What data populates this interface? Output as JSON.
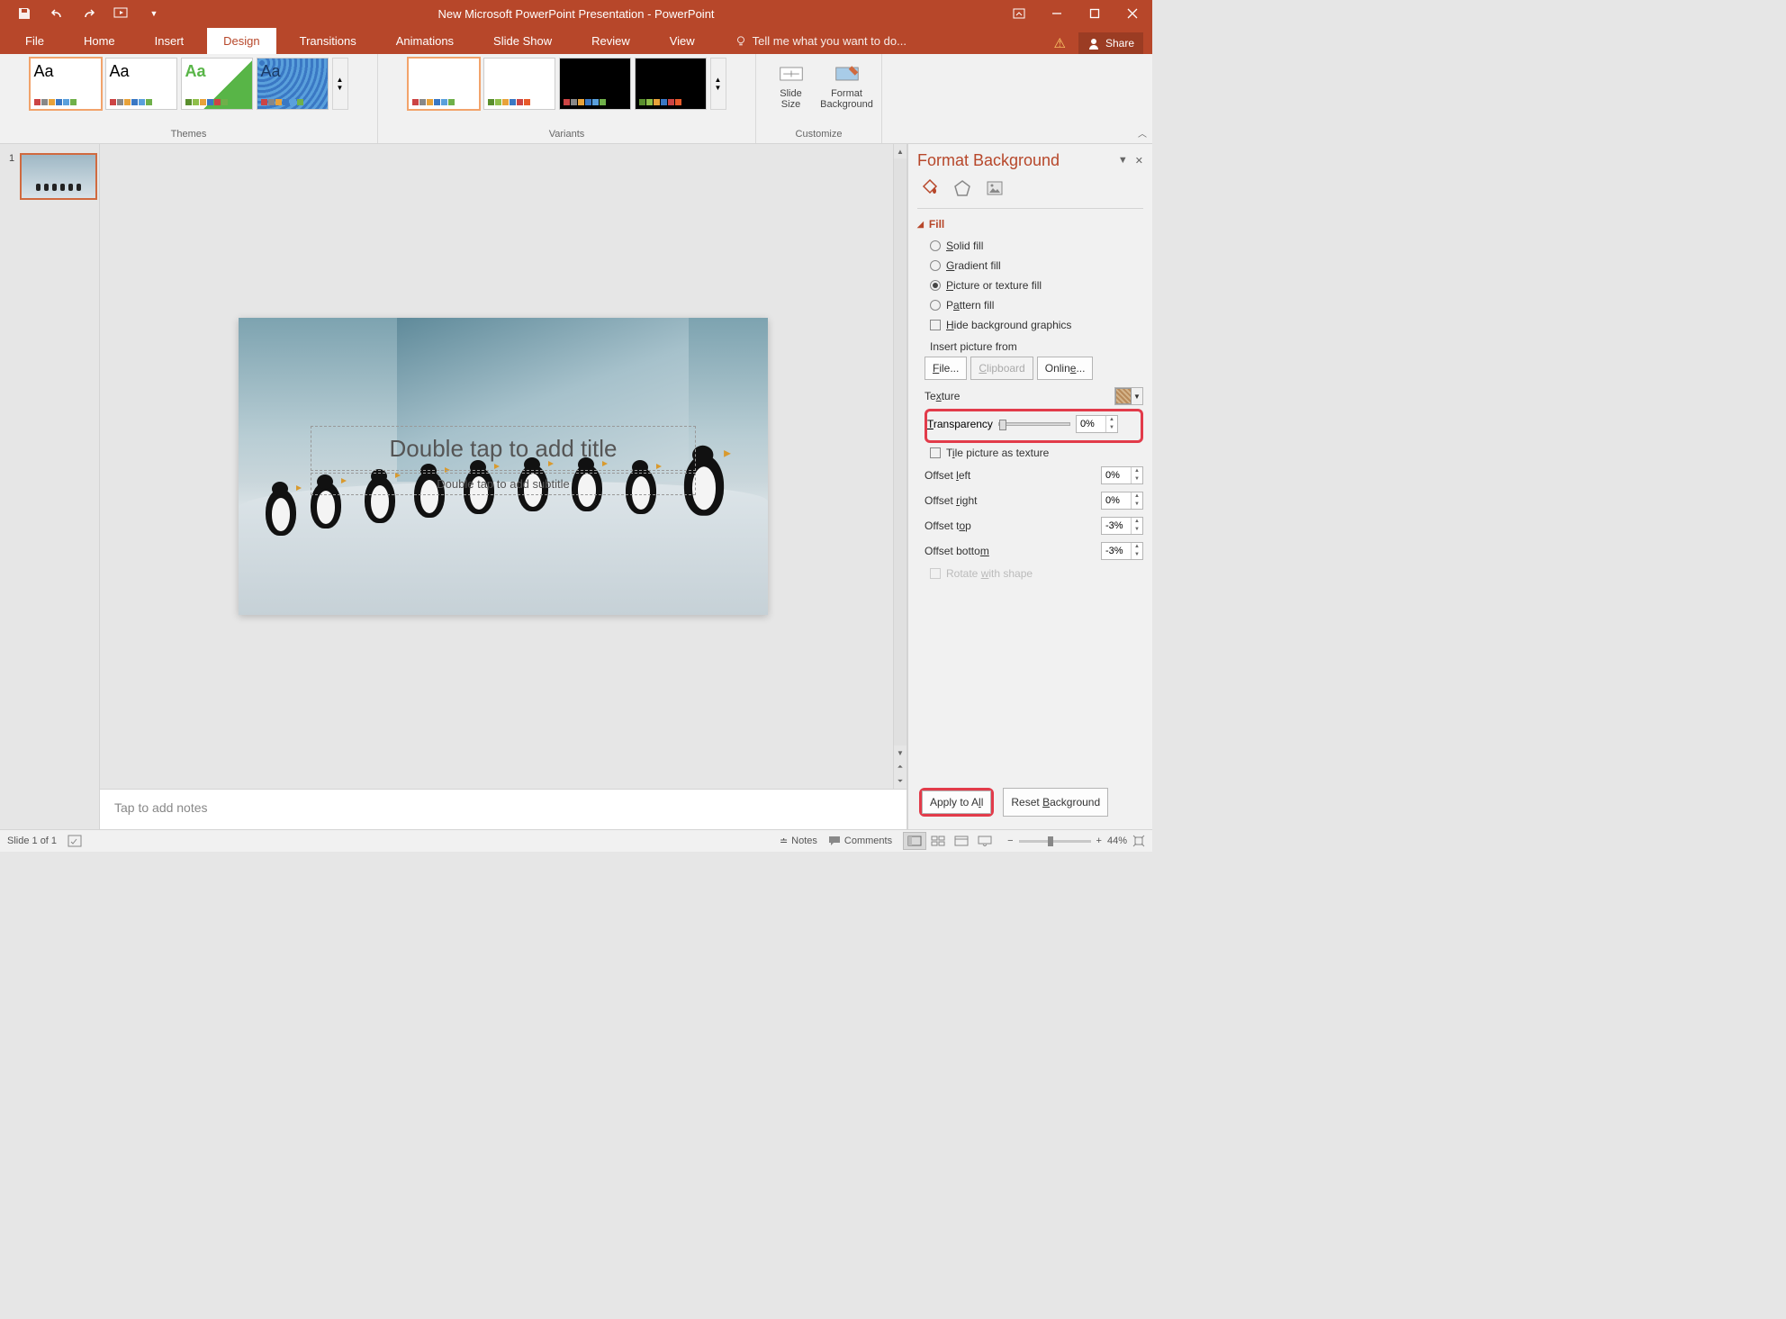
{
  "title": "New Microsoft PowerPoint Presentation - PowerPoint",
  "qat": {
    "save": "💾",
    "undo": "↶",
    "redo": "↻",
    "start": "▷",
    "more": "▾"
  },
  "tabs": {
    "file": "File",
    "home": "Home",
    "insert": "Insert",
    "design": "Design",
    "transitions": "Transitions",
    "animations": "Animations",
    "slideshow": "Slide Show",
    "review": "Review",
    "view": "View",
    "tellme": "Tell me what you want to do...",
    "share": "Share"
  },
  "ribbon": {
    "themes_label": "Themes",
    "variants_label": "Variants",
    "customize_label": "Customize",
    "slide_size": "Slide\nSize",
    "format_bg": "Format\nBackground"
  },
  "thumbs": {
    "slide1_num": "1"
  },
  "slide": {
    "title_ph": "Double tap to add title",
    "subtitle_ph": "Double tap to add subtitle",
    "notes_ph": "Tap to add notes"
  },
  "pane": {
    "title": "Format Background",
    "section_fill": "Fill",
    "solid": "Solid fill",
    "gradient": "Gradient fill",
    "picture": "Picture or texture fill",
    "pattern": "Pattern fill",
    "hide_bg": "Hide background graphics",
    "insert_from": "Insert picture from",
    "file_btn": "File...",
    "clipboard_btn": "Clipboard",
    "online_btn": "Online...",
    "texture": "Texture",
    "transparency": "Transparency",
    "transparency_val": "0%",
    "tile": "Tile picture as texture",
    "offset_left": "Offset left",
    "offset_left_v": "0%",
    "offset_right": "Offset right",
    "offset_right_v": "0%",
    "offset_top": "Offset top",
    "offset_top_v": "-3%",
    "offset_bottom": "Offset bottom",
    "offset_bottom_v": "-3%",
    "rotate": "Rotate with shape",
    "apply_all": "Apply to All",
    "reset_bg": "Reset Background"
  },
  "status": {
    "slide_info": "Slide 1 of 1",
    "notes": "Notes",
    "comments": "Comments",
    "zoom_pct": "44%"
  }
}
